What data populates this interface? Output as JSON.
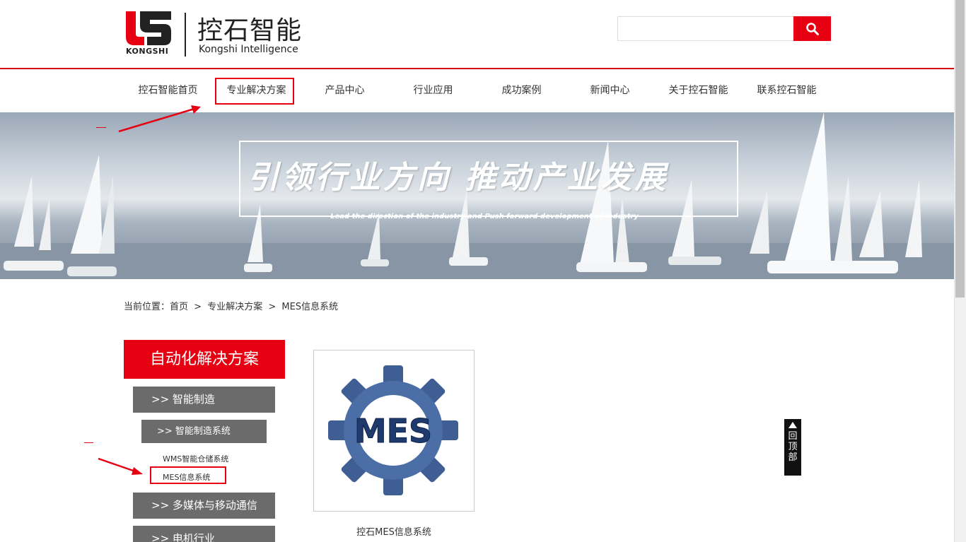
{
  "header": {
    "logo_cn": "控石智能",
    "logo_en": "Kongshi Intelligence",
    "logo_small": "KONGSHI",
    "search_placeholder": "",
    "search_icon": "search-icon",
    "accent_color": "#e60012"
  },
  "nav": {
    "items": [
      {
        "label": "控石智能首页"
      },
      {
        "label": "专业解决方案"
      },
      {
        "label": "产品中心"
      },
      {
        "label": "行业应用"
      },
      {
        "label": "成功案例"
      },
      {
        "label": "新闻中心"
      },
      {
        "label": "关于控石智能"
      },
      {
        "label": "联系控石智能"
      }
    ]
  },
  "banner": {
    "title": "引领行业方向  推动产业发展",
    "subtitle": "Lead the direction of the industry and Push forward development of industry"
  },
  "breadcrumb": {
    "prefix": "当前位置：",
    "home": "首页",
    "sep": ">",
    "level1": "专业解决方案",
    "level2": "MES信息系统"
  },
  "sidebar": {
    "title": "自动化解决方案",
    "categories": [
      {
        "label": ">> 智能制造"
      },
      {
        "label": ">> 多媒体与移动通信"
      },
      {
        "label": ">> 电机行业"
      }
    ],
    "sub_category": ">> 智能制造系统",
    "links": [
      {
        "label": "WMS智能仓储系统"
      },
      {
        "label": "MES信息系统"
      }
    ]
  },
  "product": {
    "image_text": "MES",
    "caption": "控石MES信息系统"
  },
  "back_to_top": {
    "label": "回顶部"
  }
}
